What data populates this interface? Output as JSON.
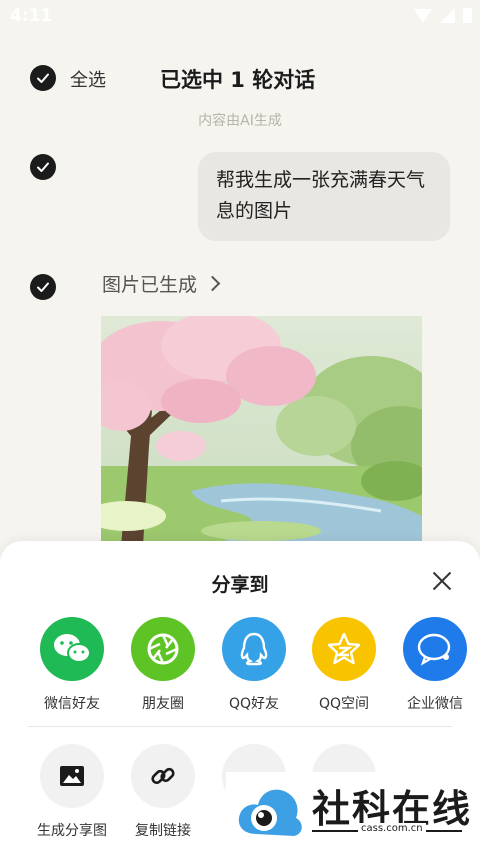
{
  "status_bar": {
    "time": "4:11"
  },
  "header": {
    "select_all_label": "全选",
    "title": "已选中 1 轮对话",
    "ai_note": "内容由AI生成"
  },
  "conversation": {
    "user_message": "帮我生成一张充满春天气息的图片",
    "image_status": "图片已生成"
  },
  "share_sheet": {
    "title": "分享到",
    "targets": [
      {
        "label": "微信好友",
        "color": "#1fb955",
        "icon": "wechat-icon"
      },
      {
        "label": "朋友圈",
        "color": "#5ec324",
        "icon": "moments-icon"
      },
      {
        "label": "QQ好友",
        "color": "#35a1e6",
        "icon": "qq-icon"
      },
      {
        "label": "QQ空间",
        "color": "#f8c400",
        "icon": "qzone-icon"
      },
      {
        "label": "企业微信",
        "color": "#1f7bea",
        "icon": "wecom-icon"
      }
    ],
    "tools": [
      {
        "label": "生成分享图",
        "icon": "image-icon"
      },
      {
        "label": "复制链接",
        "icon": "link-icon"
      }
    ]
  },
  "watermark": {
    "brand": "社科在线",
    "url": "cass.com.cn"
  }
}
